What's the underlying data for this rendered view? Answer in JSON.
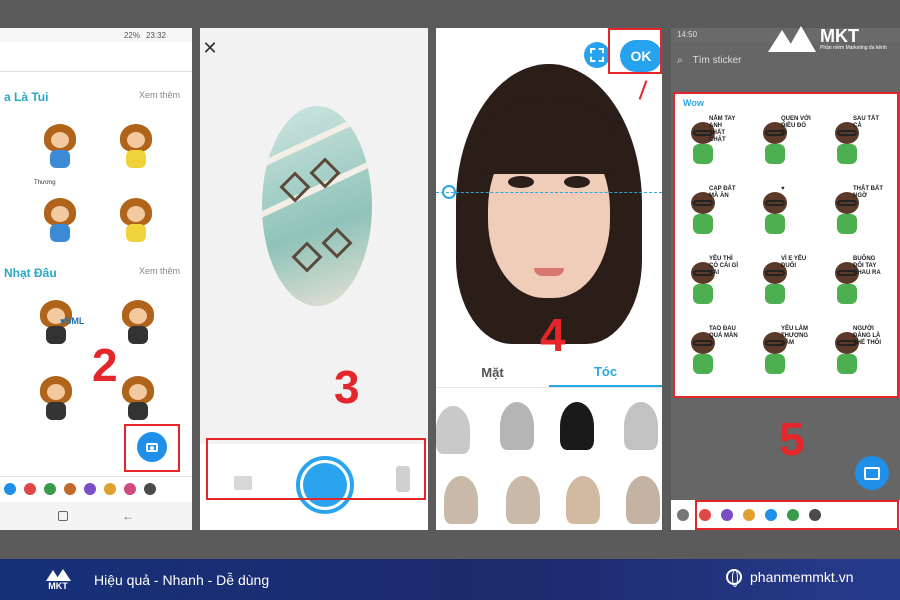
{
  "panel1": {
    "status": {
      "battery": "22%",
      "time": "23:32"
    },
    "packs": [
      {
        "title": "a Là Tui",
        "more": "Xem thêm"
      },
      {
        "title": "Nhạt Đâu",
        "more": "Xem thêm"
      }
    ],
    "sticker_texts": [
      "Thương",
      "♥SML"
    ],
    "step_number": "2"
  },
  "panel2": {
    "close": "✕",
    "step_number": "3"
  },
  "panel3": {
    "ok_label": "OK",
    "tabs": [
      "Mặt",
      "Tóc"
    ],
    "step_number": "4"
  },
  "panel4": {
    "status_time": "14:50",
    "search_placeholder": "Tìm sticker",
    "section_title": "Wow",
    "step_number": "5",
    "sticker_captions": [
      "NẮM TAY ANH THẤT CHẶT",
      "QUEN VỚI ĐIỀU ĐÓ ĐI",
      "SAU TẤT CẢ",
      "CẠP ĐẤT MÀ ĂN",
      "♥",
      "THẬT BẤT NGỜ",
      "YÊU THÌ CÓ CÁI GÌ SAI",
      "VÌ E YÊU ĐUỐI",
      "BUÔNG ĐÔI TAY NHAU RA",
      "TAO ĐAU QUÁ MÀN",
      "YÊU LÀM THƯƠNG LẮM",
      "NGƯỜI ĐÀNG LÀ THẾ THÔI"
    ]
  },
  "logo": {
    "brand": "MKT",
    "tagline": "Phần mềm Marketing đa kênh"
  },
  "footer": {
    "brand": "MKT",
    "slogan": "Hiệu quả - Nhanh - Dễ dùng",
    "website": "phanmemmkt.vn"
  },
  "colors": {
    "accent": "#26a2ee",
    "highlight": "#e4262a",
    "footer_bg": "#1d2a6b"
  }
}
